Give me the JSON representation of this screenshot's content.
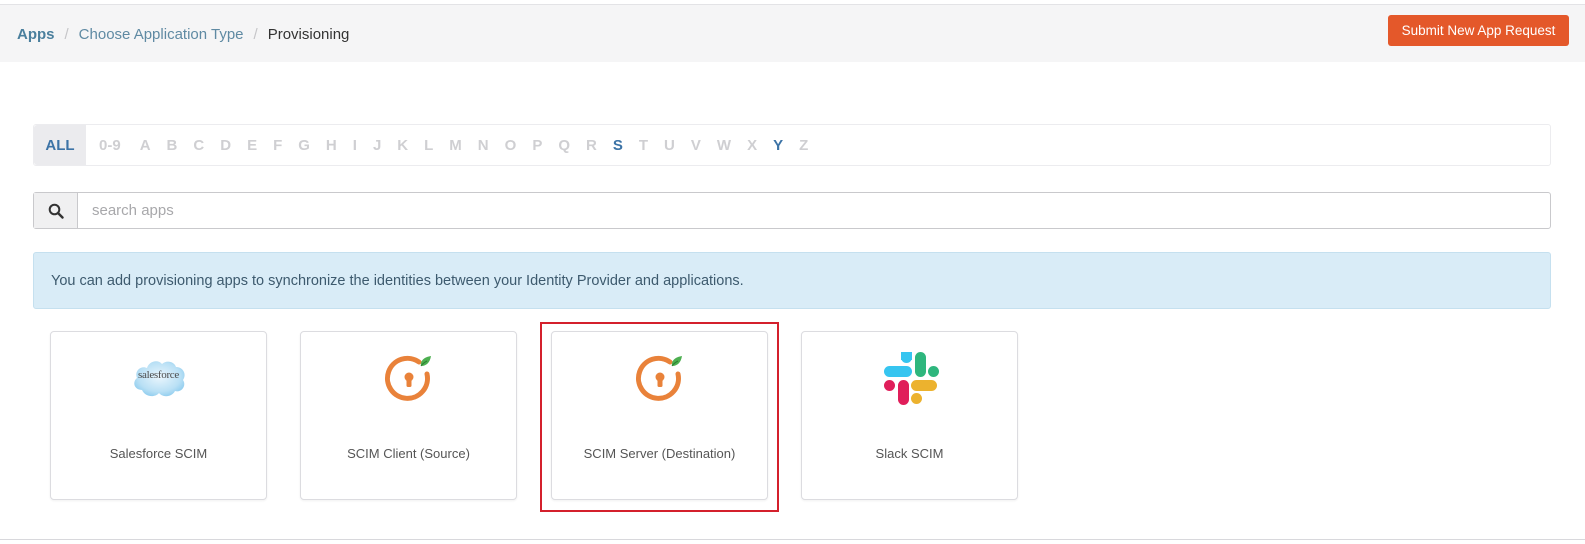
{
  "header": {
    "breadcrumb": {
      "root": "Apps",
      "middle": "Choose Application Type",
      "current": "Provisioning",
      "separator": "/"
    },
    "submit_button": "Submit New App Request"
  },
  "alphabet_filter": {
    "items": [
      "ALL",
      "0-9",
      "A",
      "B",
      "C",
      "D",
      "E",
      "F",
      "G",
      "H",
      "I",
      "J",
      "K",
      "L",
      "M",
      "N",
      "O",
      "P",
      "Q",
      "R",
      "S",
      "T",
      "U",
      "V",
      "W",
      "X",
      "Y",
      "Z"
    ],
    "selected": "ALL",
    "available": [
      "S",
      "Y"
    ]
  },
  "search": {
    "placeholder": "search apps",
    "value": "",
    "icon": "search-icon"
  },
  "info_alert": {
    "text": "You can add provisioning apps to synchronize the identities between your Identity Provider and applications."
  },
  "apps": [
    {
      "name": "Salesforce SCIM",
      "logo": "salesforce-logo",
      "logo_text": "salesforce"
    },
    {
      "name": "SCIM Client (Source)",
      "logo": "miniorange-logo"
    },
    {
      "name": "SCIM Server (Destination)",
      "logo": "miniorange-logo",
      "highlighted": true
    },
    {
      "name": "Slack SCIM",
      "logo": "slack-logo"
    }
  ],
  "colors": {
    "accent": "#e4582a",
    "link": "#4a7f9d",
    "active_letter": "#3c73a6",
    "alert_bg": "#d9ecf7",
    "highlight": "#d4202c"
  }
}
